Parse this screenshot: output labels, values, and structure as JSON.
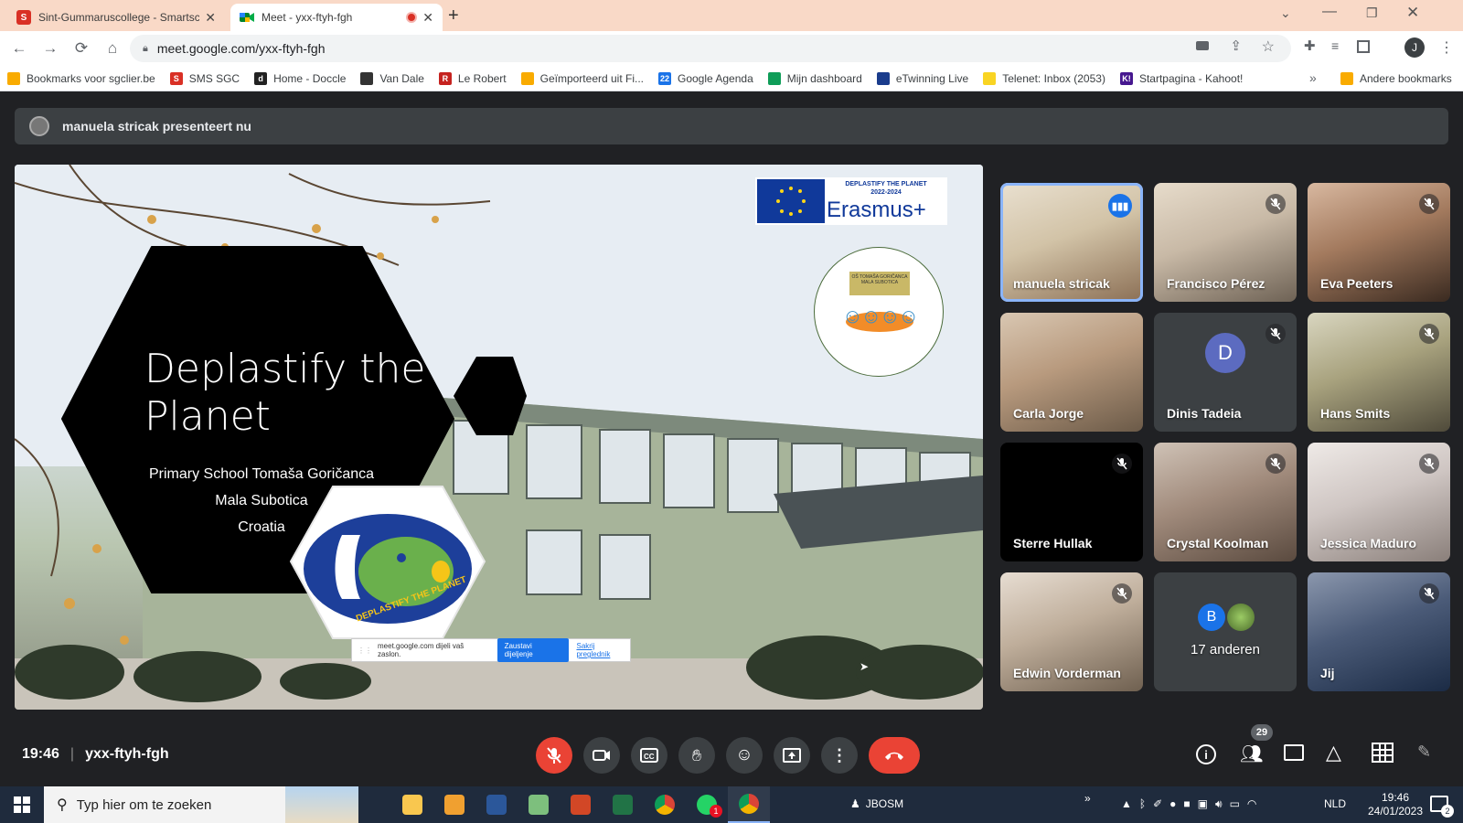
{
  "browser": {
    "tabs": [
      {
        "title": "Sint-Gummaruscollege - Smartsc",
        "favicon_letter": "S",
        "favicon_color": "#d93025"
      },
      {
        "title": "Meet - yxx-ftyh-fgh"
      }
    ],
    "url": "meet.google.com/yxx-ftyh-fgh",
    "profile_initial": "J",
    "bookmarks": [
      {
        "label": "Bookmarks voor sgclier.be",
        "color": "#f9ab00"
      },
      {
        "label": "SMS SGC",
        "color": "#d93025",
        "letter": "S"
      },
      {
        "label": "Home - Doccle",
        "color": "#222222",
        "letter": "d"
      },
      {
        "label": "Van Dale",
        "color": "#333333"
      },
      {
        "label": "Le Robert",
        "color": "#c5221f",
        "letter": "R"
      },
      {
        "label": "Geïmporteerd uit Fi...",
        "color": "#f9ab00"
      },
      {
        "label": "Google Agenda",
        "color": "#1a73e8",
        "letter": "22"
      },
      {
        "label": "Mijn dashboard",
        "color": "#0f9d58"
      },
      {
        "label": "eTwinning Live",
        "color": "#1a3c8c"
      },
      {
        "label": "Telenet: Inbox (2053)",
        "color": "#f9d423"
      },
      {
        "label": "Startpagina - Kahoot!",
        "color": "#46178f",
        "letter": "K!"
      }
    ],
    "overflow_label": "»",
    "other_bookmarks": "Andere bookmarks"
  },
  "meet": {
    "presenting_text": "manuela stricak presenteert nu",
    "slide": {
      "title": "Deplastify the Planet",
      "subtitle_lines": [
        "Primary School Tomaša Goričanca",
        "Mala Subotica",
        "Croatia"
      ],
      "erasmus_small": "DEPLASTIFY THE PLANET",
      "erasmus_years": "2022-2024",
      "erasmus_brand": "Erasmus+",
      "logo_text": "DEPLASTIFY THE PLANET",
      "school_logo_text": "OŠ TOMAŠA GORIČANCA MALA SUBOTICA"
    },
    "share_bar": {
      "text": "meet.google.com dijeli vaš zaslon.",
      "stop_label": "Zaustavi dijeljenje",
      "hide_label": "Sakrij preglednik"
    },
    "participants": [
      {
        "name": "manuela stricak",
        "type": "video",
        "active_speaker": true,
        "colors": [
          "#8b6f55",
          "#d2c3a7",
          "#e9e0d0"
        ]
      },
      {
        "name": "Francisco Pérez",
        "type": "video",
        "muted": true,
        "colors": [
          "#6e6255",
          "#c8b9a6",
          "#e7dccb"
        ]
      },
      {
        "name": "Eva Peeters",
        "type": "video",
        "muted": true,
        "colors": [
          "#3a2a20",
          "#a37a5e",
          "#d8b8a0"
        ]
      },
      {
        "name": "Carla Jorge",
        "type": "video",
        "colors": [
          "#6b5a48",
          "#b89a7e",
          "#d9c7b2"
        ]
      },
      {
        "name": "Dinis Tadeia",
        "type": "avatar",
        "initial": "D",
        "avatar_color": "#5c6bc0",
        "muted": true
      },
      {
        "name": "Hans Smits",
        "type": "video",
        "muted": true,
        "colors": [
          "#4f4a3a",
          "#a8a27e",
          "#d9d6c0"
        ]
      },
      {
        "name": "Sterre Hullak",
        "type": "dark",
        "muted": true
      },
      {
        "name": "Crystal Koolman",
        "type": "video",
        "muted": true,
        "colors": [
          "#5a4a3f",
          "#a18b7c",
          "#cfc2b6"
        ]
      },
      {
        "name": "Jessica Maduro",
        "type": "video",
        "muted": true,
        "colors": [
          "#8a7f7a",
          "#cfc6c3",
          "#efeae7"
        ]
      },
      {
        "name": "Edwin Vorderman",
        "type": "video",
        "muted": true,
        "colors": [
          "#6f6050",
          "#bfae9b",
          "#e7ddd2"
        ]
      },
      {
        "name": "17 anderen",
        "type": "others",
        "initial": "B",
        "avatar_color": "#1a73e8"
      },
      {
        "name": "Jij",
        "type": "video",
        "muted": true,
        "colors": [
          "#1b2b45",
          "#4b5b78",
          "#8b97ad"
        ]
      }
    ],
    "time": "19:46",
    "meeting_code": "yxx-ftyh-fgh",
    "people_count": "29"
  },
  "taskbar": {
    "search_placeholder": "Typ hier om te zoeken",
    "pinned_label": "JBOSM",
    "whatsapp_badge": "1",
    "language": "NLD",
    "clock_time": "19:46",
    "clock_date": "24/01/2023",
    "notification_count": "2"
  },
  "colors": {
    "meet_bg": "#202124",
    "control_gray": "#3c4043",
    "hangup_red": "#ea4335",
    "accent_blue": "#8ab4f8"
  }
}
